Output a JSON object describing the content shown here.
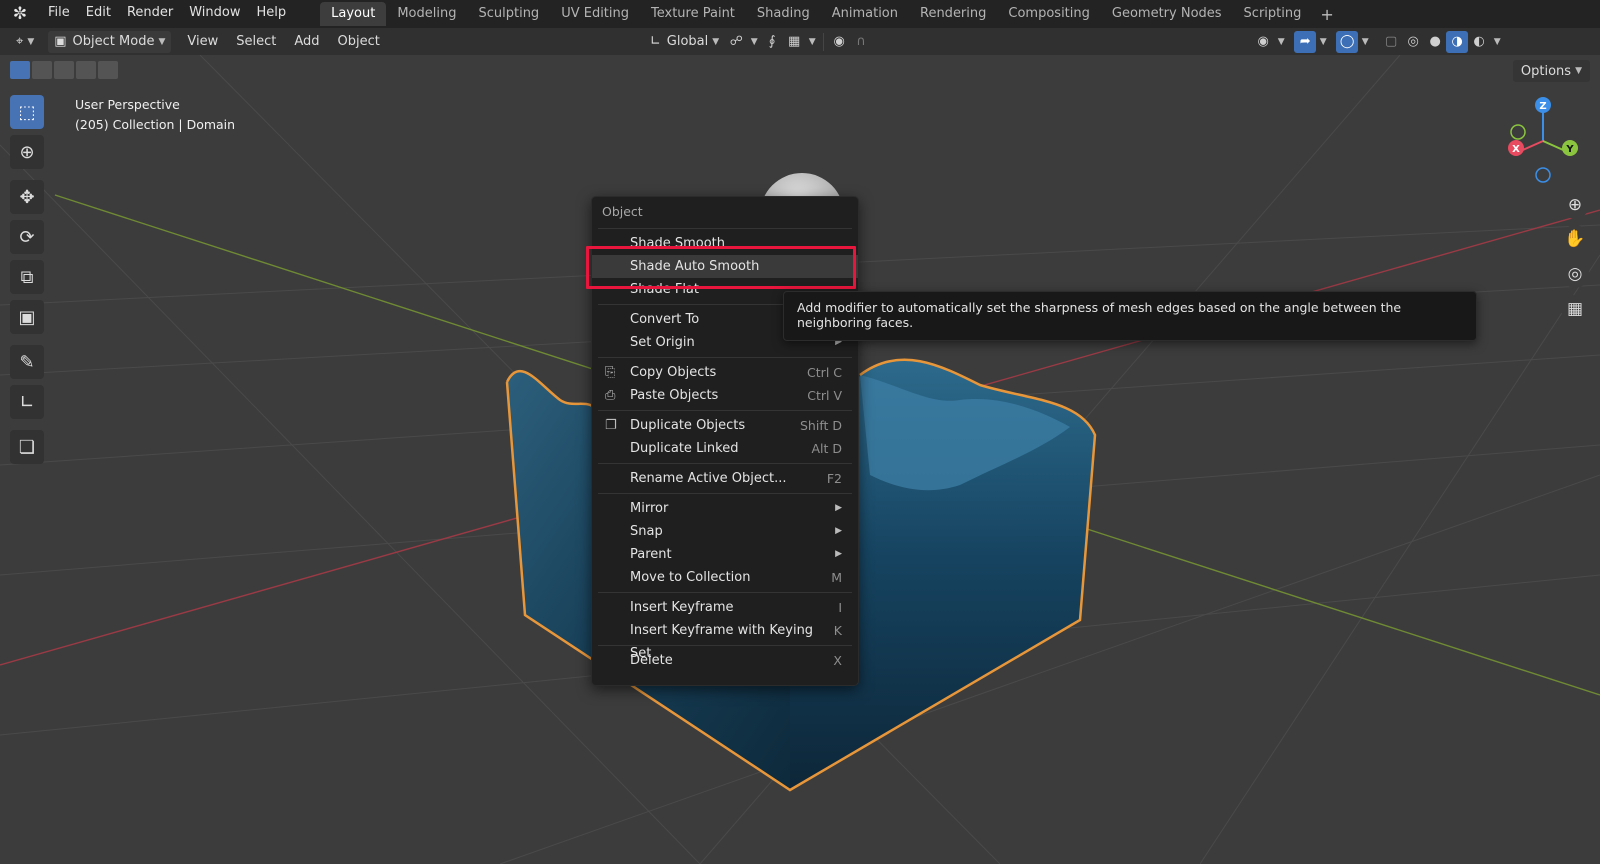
{
  "app": {
    "menus": [
      "File",
      "Edit",
      "Render",
      "Window",
      "Help"
    ],
    "workspaces": [
      "Layout",
      "Modeling",
      "Sculpting",
      "UV Editing",
      "Texture Paint",
      "Shading",
      "Animation",
      "Rendering",
      "Compositing",
      "Geometry Nodes",
      "Scripting"
    ],
    "active_workspace": "Layout",
    "add_workspace": "+"
  },
  "header": {
    "mode": "Object Mode",
    "menus": [
      "View",
      "Select",
      "Add",
      "Object"
    ],
    "transform_orientation": "Global",
    "options_label": "Options"
  },
  "viewport": {
    "view_name": "User Perspective",
    "collection_info": "(205) Collection | Domain",
    "gizmo_axes": {
      "x": "X",
      "y": "Y",
      "z": "Z"
    },
    "colors": {
      "x": "#e84a5f",
      "y": "#8bc53f",
      "z": "#3b8fe8",
      "selection": "#e8963a",
      "accent": "#4772b3"
    }
  },
  "context_menu": {
    "title": "Object",
    "groups": [
      [
        {
          "label": "Shade Smooth",
          "shortcut": ""
        },
        {
          "label": "Shade Auto Smooth",
          "shortcut": "",
          "highlighted": true
        },
        {
          "label": "Shade Flat",
          "shortcut": ""
        }
      ],
      [
        {
          "label": "Convert To",
          "shortcut": "",
          "submenu": true
        },
        {
          "label": "Set Origin",
          "shortcut": "",
          "submenu": true
        }
      ],
      [
        {
          "label": "Copy Objects",
          "shortcut": "Ctrl C",
          "icon": "copy-icon"
        },
        {
          "label": "Paste Objects",
          "shortcut": "Ctrl V",
          "icon": "paste-icon"
        }
      ],
      [
        {
          "label": "Duplicate Objects",
          "shortcut": "Shift D",
          "icon": "duplicate-icon"
        },
        {
          "label": "Duplicate Linked",
          "shortcut": "Alt D"
        }
      ],
      [
        {
          "label": "Rename Active Object...",
          "shortcut": "F2"
        }
      ],
      [
        {
          "label": "Mirror",
          "shortcut": "",
          "submenu": true
        },
        {
          "label": "Snap",
          "shortcut": "",
          "submenu": true
        },
        {
          "label": "Parent",
          "shortcut": "",
          "submenu": true
        },
        {
          "label": "Move to Collection",
          "shortcut": "M"
        }
      ],
      [
        {
          "label": "Insert Keyframe",
          "shortcut": "I"
        },
        {
          "label": "Insert Keyframe with Keying Set",
          "shortcut": "K"
        }
      ],
      [
        {
          "label": "Delete",
          "shortcut": "X"
        }
      ]
    ]
  },
  "tooltip": {
    "text": "Add modifier to automatically set the sharpness of mesh edges based on the angle between the neighboring faces."
  }
}
